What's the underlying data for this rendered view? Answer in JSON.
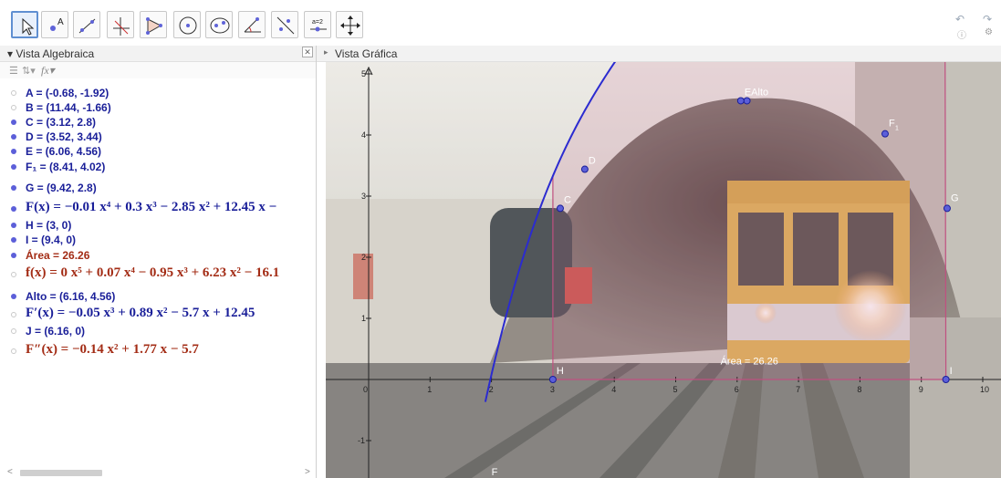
{
  "toolbar": {
    "tools": [
      {
        "name": "move-tool",
        "icon": "cursor-arrow-icon"
      },
      {
        "name": "point-tool",
        "icon": "point-icon"
      },
      {
        "name": "line-tool",
        "icon": "line-icon"
      },
      {
        "name": "perpendicular-tool",
        "icon": "perpendicular-icon"
      },
      {
        "name": "polygon-tool",
        "icon": "polygon-icon"
      },
      {
        "name": "circle-tool",
        "icon": "circle-icon"
      },
      {
        "name": "conic-tool",
        "icon": "ellipse-icon"
      },
      {
        "name": "angle-tool",
        "icon": "angle-icon"
      },
      {
        "name": "reflect-tool",
        "icon": "reflect-icon"
      },
      {
        "name": "slider-tool",
        "icon": "slider-icon",
        "label": "a=2"
      },
      {
        "name": "move-view-tool",
        "icon": "move-arrows-icon"
      }
    ],
    "undo_icon": "undo-icon",
    "redo_icon": "redo-icon"
  },
  "algebra_view": {
    "title": "Vista Algebraica",
    "rows": [
      {
        "text": "A = (-0.68, -1.92)",
        "visible": false,
        "color": "blue",
        "math": false
      },
      {
        "text": "B = (11.44, -1.66)",
        "visible": false,
        "color": "blue",
        "math": false
      },
      {
        "text": "C = (3.12, 2.8)",
        "visible": true,
        "color": "blue",
        "math": false
      },
      {
        "text": "D = (3.52, 3.44)",
        "visible": true,
        "color": "blue",
        "math": false
      },
      {
        "text": "E = (6.06, 4.56)",
        "visible": true,
        "color": "blue",
        "math": false
      },
      {
        "text": "F₁ = (8.41, 4.02)",
        "visible": true,
        "color": "blue",
        "math": false
      },
      {
        "text": "G = (9.42, 2.8)",
        "visible": true,
        "color": "blue",
        "math": false
      },
      {
        "text": "F(x) = −0.01 x⁴ + 0.3 x³ − 2.85 x² + 12.45 x −",
        "visible": true,
        "color": "blue",
        "math": true
      },
      {
        "text": "H = (3, 0)",
        "visible": true,
        "color": "blue",
        "math": false
      },
      {
        "text": "I = (9.4, 0)",
        "visible": true,
        "color": "blue",
        "math": false
      },
      {
        "text": "Área = 26.26",
        "visible": true,
        "color": "red",
        "math": false
      },
      {
        "text": "f(x) = 0 x⁵ + 0.07 x⁴ − 0.95 x³ + 6.23 x² − 16.1",
        "visible": false,
        "color": "red",
        "math": true
      },
      {
        "text": "Alto = (6.16, 4.56)",
        "visible": true,
        "color": "blue",
        "math": false
      },
      {
        "text": "F′(x) = −0.05 x³ + 0.89 x² − 5.7 x + 12.45",
        "visible": false,
        "color": "blue",
        "math": true
      },
      {
        "text": "J = (6.16, 0)",
        "visible": false,
        "color": "blue",
        "math": false
      },
      {
        "text": "F″(x) = −0.14 x² + 1.77 x − 5.7",
        "visible": false,
        "color": "red",
        "math": true
      }
    ]
  },
  "graphics_view": {
    "title": "Vista Gráfica",
    "x_ticks": [
      "0",
      "1",
      "2",
      "3",
      "4",
      "5",
      "6",
      "7",
      "8",
      "9",
      "10"
    ],
    "y_ticks": [
      "-1",
      "1",
      "2",
      "3",
      "4",
      "5"
    ],
    "point_labels": {
      "C": "C",
      "D": "D",
      "E": "EAlto",
      "F1": "F",
      "F1_sub": "1",
      "G": "G",
      "H": "H",
      "I": "I",
      "F": "F"
    },
    "area_label": "Área = 26.26",
    "curve_color": "#2b2bd0",
    "area_color": "#c05080"
  }
}
